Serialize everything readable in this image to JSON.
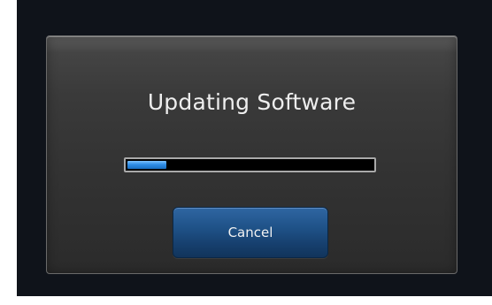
{
  "dialog": {
    "title": "Updating Software",
    "progress": {
      "fraction": 0.16,
      "fill_color": "#2f8ee6"
    },
    "cancel_label": "Cancel"
  }
}
